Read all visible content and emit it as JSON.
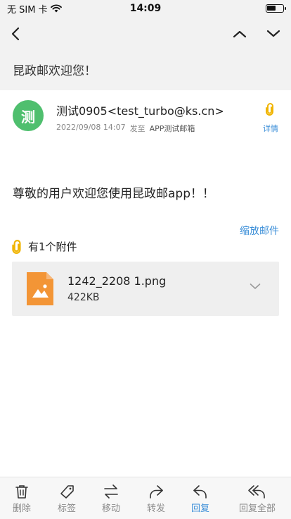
{
  "status_bar": {
    "carrier": "无 SIM 卡",
    "time": "14:09"
  },
  "header": {
    "subject": "昆政邮欢迎您！"
  },
  "sender": {
    "avatar_char": "测",
    "display": "测试0905<test_turbo@ks.cn>",
    "datetime": "2022/09/08 14:07",
    "sent_to_label": "发至",
    "recipient": "APP测试邮箱",
    "detail_label": "详情"
  },
  "mail": {
    "body": "尊敬的用户欢迎您使用昆政邮app！！",
    "zoom_label": "缩放邮件"
  },
  "attachments": {
    "heading": "有1个附件",
    "items": [
      {
        "name": "1242_2208 1.png",
        "size": "422KB"
      }
    ]
  },
  "toolbar": {
    "items": [
      {
        "label": "删除",
        "icon": "trash-icon"
      },
      {
        "label": "标签",
        "icon": "tag-icon"
      },
      {
        "label": "移动",
        "icon": "move-icon"
      },
      {
        "label": "转发",
        "icon": "forward-icon"
      },
      {
        "label": "回复",
        "icon": "reply-icon"
      },
      {
        "label": "回复全部",
        "icon": "reply-all-icon"
      }
    ]
  },
  "colors": {
    "accent": "#3a8ed8",
    "avatar": "#4fbf6e",
    "clip": "#f0b400",
    "file_icon": "#f39536"
  }
}
